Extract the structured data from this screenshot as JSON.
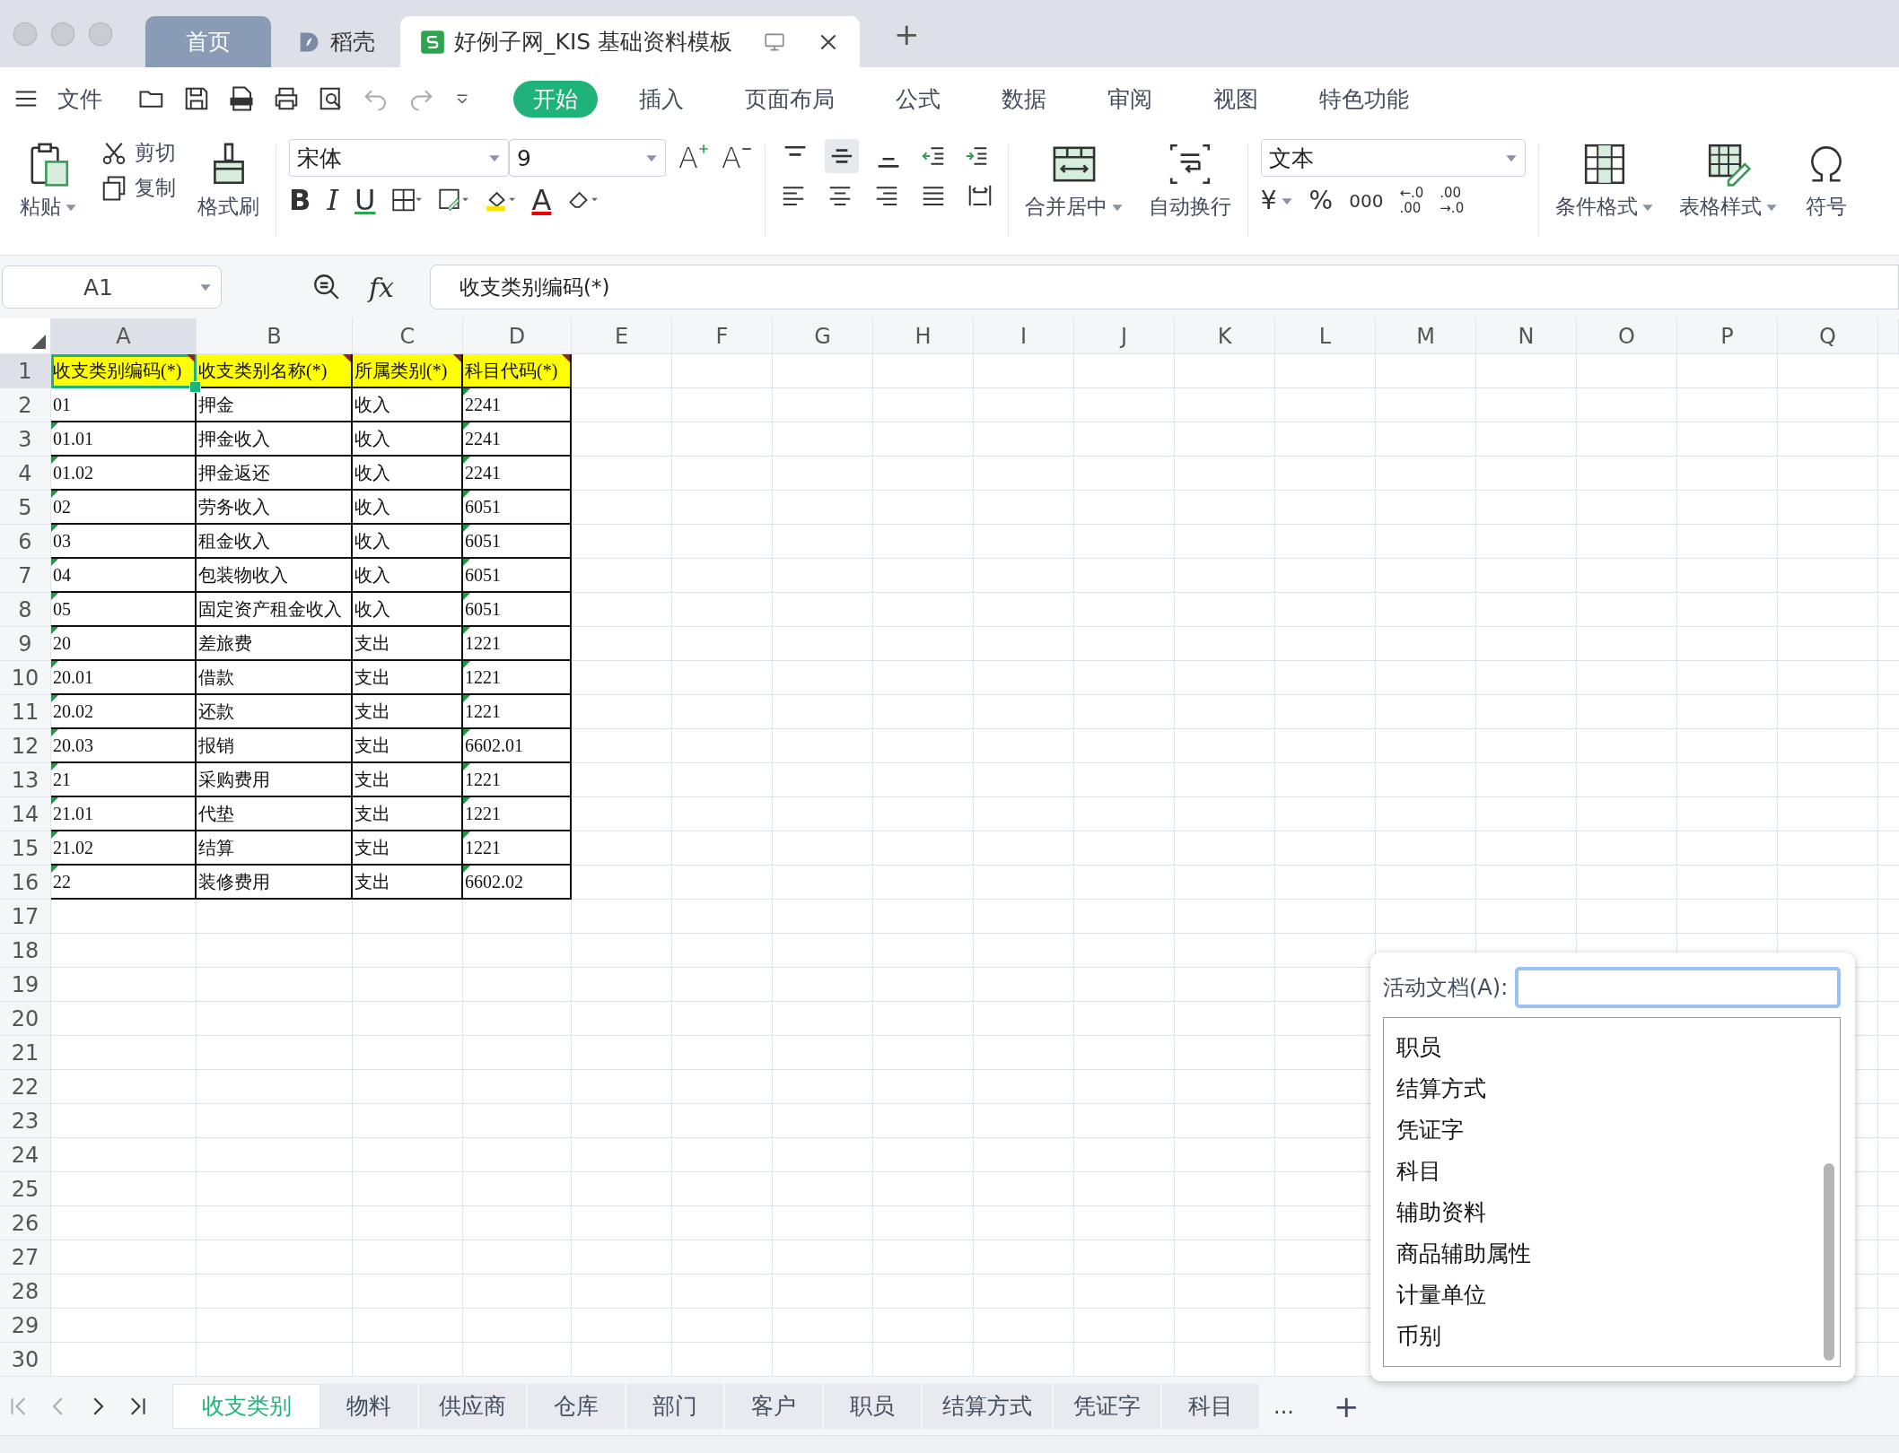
{
  "tabs": [
    {
      "kind": "home",
      "label": "首页",
      "selected": false
    },
    {
      "kind": "docer",
      "label": "稻壳",
      "selected": false
    },
    {
      "kind": "sheet",
      "label": "好例子网_KIS 基础资料模板",
      "selected": true
    }
  ],
  "new_tab": "+",
  "menu": {
    "file": "文件",
    "items": [
      {
        "label": "开始",
        "selected": true
      },
      {
        "label": "插入",
        "selected": false
      },
      {
        "label": "页面布局",
        "selected": false
      },
      {
        "label": "公式",
        "selected": false
      },
      {
        "label": "数据",
        "selected": false
      },
      {
        "label": "审阅",
        "selected": false
      },
      {
        "label": "视图",
        "selected": false
      },
      {
        "label": "特色功能",
        "selected": false
      }
    ]
  },
  "ribbon": {
    "paste": "粘贴",
    "cut": "剪切",
    "copy": "复制",
    "format_painter": "格式刷",
    "font": "宋体",
    "font_size": "9",
    "grow": "A",
    "shrink": "A",
    "bold": "B",
    "italic": "I",
    "underline": "U",
    "font_color": "A",
    "align_buttons": [
      {
        "kind": "top",
        "selected": false
      },
      {
        "kind": "middle",
        "selected": true
      },
      {
        "kind": "bottom",
        "selected": false
      }
    ],
    "merge": "合并居中",
    "wrap": "自动换行",
    "number_format": "文本",
    "currency": "¥",
    "percent": "%",
    "thousands": "000",
    "decimal_add": [
      "←.0",
      ".00"
    ],
    "decimal_remove": [
      ".00",
      "→.0"
    ],
    "conditional": "条件格式",
    "table_style": "表格样式",
    "symbol": "符号"
  },
  "formula_bar": {
    "name_box": "A1",
    "fx": "fx",
    "value": "收支类别编码(*)"
  },
  "sheet": {
    "columns": [
      {
        "label": "A",
        "selected": true
      },
      {
        "label": "B",
        "selected": false
      },
      {
        "label": "C",
        "selected": false
      },
      {
        "label": "D",
        "selected": false
      },
      {
        "label": "E",
        "selected": false
      },
      {
        "label": "F",
        "selected": false
      },
      {
        "label": "G",
        "selected": false
      },
      {
        "label": "H",
        "selected": false
      },
      {
        "label": "I",
        "selected": false
      },
      {
        "label": "J",
        "selected": false
      },
      {
        "label": "K",
        "selected": false
      },
      {
        "label": "L",
        "selected": false
      },
      {
        "label": "M",
        "selected": false
      },
      {
        "label": "N",
        "selected": false
      },
      {
        "label": "O",
        "selected": false
      },
      {
        "label": "P",
        "selected": false
      },
      {
        "label": "Q",
        "selected": false
      }
    ],
    "row_numbers": [
      {
        "label": "1",
        "selected": true
      },
      {
        "label": "2",
        "selected": false
      },
      {
        "label": "3",
        "selected": false
      },
      {
        "label": "4",
        "selected": false
      },
      {
        "label": "5",
        "selected": false
      },
      {
        "label": "6",
        "selected": false
      },
      {
        "label": "7",
        "selected": false
      },
      {
        "label": "8",
        "selected": false
      },
      {
        "label": "9",
        "selected": false
      },
      {
        "label": "10",
        "selected": false
      },
      {
        "label": "11",
        "selected": false
      },
      {
        "label": "12",
        "selected": false
      },
      {
        "label": "13",
        "selected": false
      },
      {
        "label": "14",
        "selected": false
      },
      {
        "label": "15",
        "selected": false
      },
      {
        "label": "16",
        "selected": false
      },
      {
        "label": "17",
        "selected": false
      },
      {
        "label": "18",
        "selected": false
      },
      {
        "label": "19",
        "selected": false
      },
      {
        "label": "20",
        "selected": false
      },
      {
        "label": "21",
        "selected": false
      },
      {
        "label": "22",
        "selected": false
      },
      {
        "label": "23",
        "selected": false
      },
      {
        "label": "24",
        "selected": false
      },
      {
        "label": "25",
        "selected": false
      },
      {
        "label": "26",
        "selected": false
      },
      {
        "label": "27",
        "selected": false
      },
      {
        "label": "28",
        "selected": false
      },
      {
        "label": "29",
        "selected": false
      },
      {
        "label": "30",
        "selected": false
      }
    ],
    "rows": [
      {
        "kind": "header",
        "cells": [
          "收支类别编码(*)",
          "收支类别名称(*)",
          "所属类别(*)",
          "科目代码(*)"
        ],
        "flags": [
          true,
          true,
          true,
          true
        ]
      },
      {
        "kind": "data",
        "cells": [
          "01",
          "押金",
          "收入",
          "2241"
        ],
        "flags": [
          false,
          false,
          false,
          true
        ]
      },
      {
        "kind": "data",
        "cells": [
          "01.01",
          "押金收入",
          "收入",
          "2241"
        ],
        "flags": [
          true,
          false,
          false,
          true
        ]
      },
      {
        "kind": "data",
        "cells": [
          "01.02",
          "押金返还",
          "收入",
          "2241"
        ],
        "flags": [
          true,
          false,
          false,
          true
        ]
      },
      {
        "kind": "data",
        "cells": [
          "02",
          "劳务收入",
          "收入",
          "6051"
        ],
        "flags": [
          true,
          false,
          false,
          true
        ]
      },
      {
        "kind": "data",
        "cells": [
          "03",
          "租金收入",
          "收入",
          "6051"
        ],
        "flags": [
          true,
          false,
          false,
          true
        ]
      },
      {
        "kind": "data",
        "cells": [
          "04",
          "包装物收入",
          "收入",
          "6051"
        ],
        "flags": [
          true,
          false,
          false,
          true
        ]
      },
      {
        "kind": "data",
        "cells": [
          "05",
          "固定资产租金收入",
          "收入",
          "6051"
        ],
        "flags": [
          true,
          false,
          false,
          true
        ]
      },
      {
        "kind": "data",
        "cells": [
          "20",
          "差旅费",
          "支出",
          "1221"
        ],
        "flags": [
          true,
          false,
          false,
          true
        ]
      },
      {
        "kind": "data",
        "cells": [
          "20.01",
          "借款",
          "支出",
          "1221"
        ],
        "flags": [
          true,
          false,
          false,
          true
        ]
      },
      {
        "kind": "data",
        "cells": [
          "20.02",
          "还款",
          "支出",
          "1221"
        ],
        "flags": [
          true,
          false,
          false,
          true
        ]
      },
      {
        "kind": "data",
        "cells": [
          "20.03",
          "报销",
          "支出",
          "6602.01"
        ],
        "flags": [
          true,
          false,
          false,
          true
        ]
      },
      {
        "kind": "data",
        "cells": [
          "21",
          "采购费用",
          "支出",
          "1221"
        ],
        "flags": [
          true,
          false,
          false,
          true
        ]
      },
      {
        "kind": "data",
        "cells": [
          "21.01",
          "代垫",
          "支出",
          "1221"
        ],
        "flags": [
          true,
          false,
          false,
          true
        ]
      },
      {
        "kind": "data",
        "cells": [
          "21.02",
          "结算",
          "支出",
          "1221"
        ],
        "flags": [
          true,
          false,
          false,
          true
        ]
      },
      {
        "kind": "data",
        "cells": [
          "22",
          "装修费用",
          "支出",
          "6602.02"
        ],
        "flags": [
          true,
          false,
          false,
          true
        ]
      }
    ]
  },
  "popup": {
    "label": "活动文档(A):",
    "items": [
      "职员",
      "结算方式",
      "凭证字",
      "科目",
      "辅助资料",
      "商品辅助属性",
      "计量单位",
      "币别"
    ]
  },
  "sheet_tabs": [
    {
      "label": "收支类别",
      "selected": true
    },
    {
      "label": "物料",
      "selected": false
    },
    {
      "label": "供应商",
      "selected": false
    },
    {
      "label": "仓库",
      "selected": false
    },
    {
      "label": "部门",
      "selected": false
    },
    {
      "label": "客户",
      "selected": false
    },
    {
      "label": "职员",
      "selected": false
    },
    {
      "label": "结算方式",
      "selected": false
    },
    {
      "label": "凭证字",
      "selected": false
    },
    {
      "label": "科目",
      "selected": false
    }
  ],
  "more_tabs": "...",
  "add_sheet": "+"
}
